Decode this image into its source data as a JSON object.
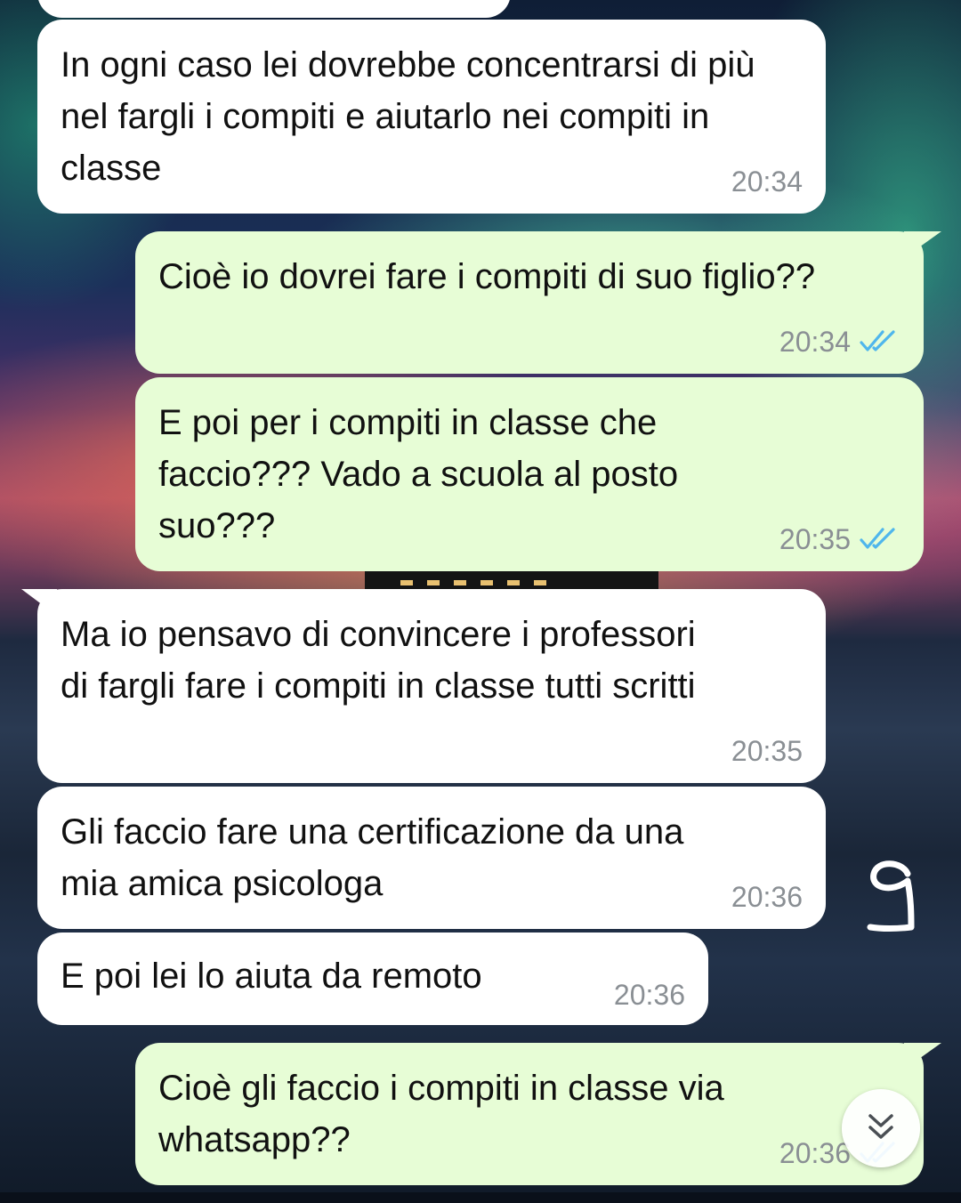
{
  "messages": [
    {
      "direction": "incoming",
      "text": "In ogni caso lei dovrebbe concentrarsi di più nel fargli i compiti e aiutarlo nei compiti in classe",
      "time": "20:34"
    },
    {
      "direction": "outgoing",
      "text": "Cioè io dovrei fare i compiti di suo figlio??",
      "time": "20:34",
      "status": "read"
    },
    {
      "direction": "outgoing",
      "text": "E poi per i compiti in classe che faccio??? Vado a scuola al posto suo???",
      "time": "20:35",
      "status": "read"
    },
    {
      "direction": "incoming",
      "text": "Ma io pensavo di convincere i professori di fargli fare i compiti in classe tutti scritti",
      "time": "20:35"
    },
    {
      "direction": "incoming",
      "text": "Gli faccio fare una certificazione da una mia amica psicologa",
      "time": "20:36"
    },
    {
      "direction": "incoming",
      "text": "E poi lei lo aiuta da remoto",
      "time": "20:36"
    },
    {
      "direction": "outgoing",
      "text": "Cioè gli faccio i compiti in classe via whatsapp??",
      "time": "20:36",
      "status": "read"
    }
  ],
  "annotation": "9",
  "icons": {
    "read_ticks": "double-check-icon",
    "scroll_down": "double-chevron-down-icon"
  },
  "colors": {
    "incoming_bubble": "#ffffff",
    "outgoing_bubble": "#e7fdd6",
    "timestamp": "#8a8f94",
    "read_tick": "#4fb6ec"
  }
}
